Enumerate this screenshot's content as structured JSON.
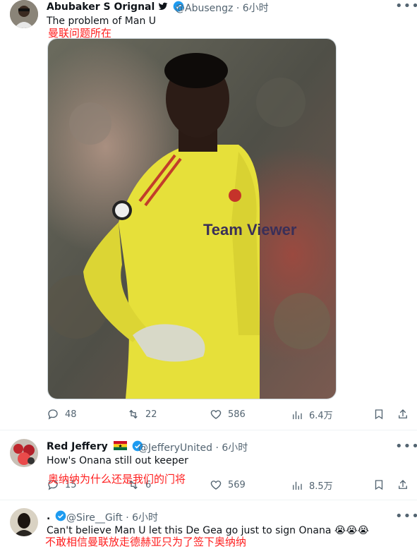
{
  "tweets": [
    {
      "author": "Abubaker S Orignal",
      "author_flag": "🐦",
      "handle": "@Abusengz",
      "time": "· 6小时",
      "text": "The problem of Man U",
      "translation": "曼联问题所在",
      "has_image": true,
      "image_text": "Team Viewer",
      "stats": {
        "replies": "48",
        "retweets": "22",
        "likes": "586",
        "views": "6.4万"
      }
    },
    {
      "author": "Red Jeffery",
      "author_flag": "ghana-flag",
      "handle": "@JefferyUnited",
      "time": "· 6小时",
      "text": "How's Onana still out keeper",
      "translation": "奥纳纳为什么还是我们的门将",
      "stats": {
        "replies": "15",
        "retweets": "6",
        "likes": "569",
        "views": "8.5万"
      }
    },
    {
      "author": ".",
      "handle": "@Sire__Gift",
      "time": "· 6小时",
      "text": "Can't believe Man U let this De Gea go just to sign Onana 😭😭😭",
      "translation": "不敢相信曼联放走德赫亚只为了签下奥纳纳"
    }
  ],
  "colors": {
    "accent": "#1d9bf0",
    "translation": "#ff1e1e",
    "muted": "#536471",
    "kit": "#e8e23a"
  }
}
